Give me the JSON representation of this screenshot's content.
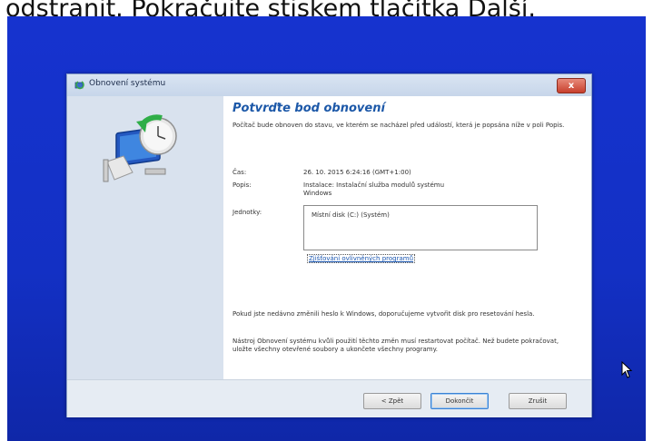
{
  "caption": "odstranit. Pokračujte stiskem tlačítka Další.",
  "dialog": {
    "title": "Obnovení systému",
    "close_glyph": "x",
    "heading": "Potvrďte bod obnovení",
    "intro": "Počítač bude obnoven do stavu, ve kterém se nacházel před událostí, která je popsána níže v poli Popis.",
    "time_label": "Čas:",
    "time_value": "26. 10. 2015 6:24:16 (GMT+1:00)",
    "desc_label": "Popis:",
    "desc_value": "Instalace: Instalační služba modulů systému Windows",
    "drives_label": "Jednotky:",
    "drives": [
      "Místní disk (C:) (Systém)"
    ],
    "scan_link": "Zjišťování ovlivněných programů",
    "password_note": "Pokud jste nedávno změnili heslo k Windows, doporučujeme vytvořit disk pro resetování hesla.",
    "restart_note": "Nástroj Obnovení systému kvůli použití těchto změn musí restartovat počítač. Než budete pokračovat, uložte všechny otevřené soubory a ukončete všechny programy.",
    "buttons": {
      "back": "< Zpět",
      "finish": "Dokončit",
      "cancel": "Zrušit"
    }
  },
  "colors": {
    "desktop": "#1530c8",
    "heading": "#1c58a8",
    "link": "#1a56b0"
  },
  "icons": {
    "title": "system-restore-icon",
    "illustration": "computer-restore-icon",
    "cursor": "mouse-pointer-icon"
  }
}
